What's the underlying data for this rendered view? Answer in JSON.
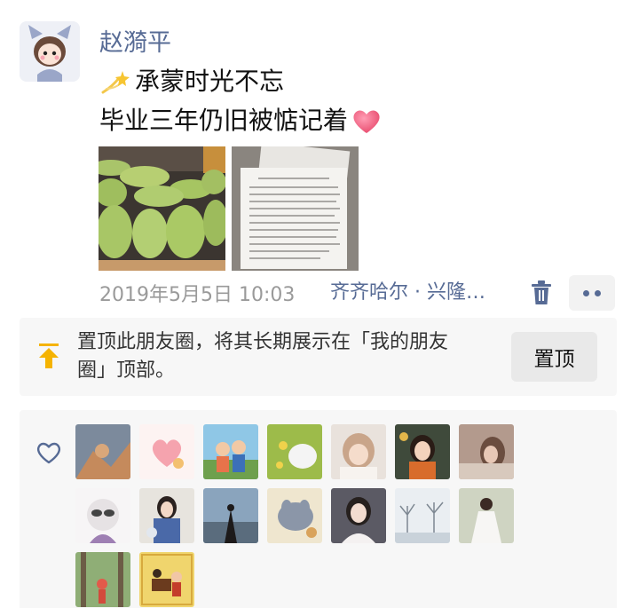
{
  "post": {
    "author": "赵漪平",
    "line1": "承蒙时光不忘",
    "line2": "毕业三年仍旧被惦记着",
    "timestamp": "2019年5月5日 10:03",
    "location": "齐齐哈尔 · 兴隆…"
  },
  "pin_notice": {
    "text": "置顶此朋友圈，将其长期展示在「我的朋友圈」顶部。",
    "button_label": "置顶"
  },
  "colors": {
    "link_blue": "#576b95",
    "pin_yellow": "#f5b301",
    "panel_bg": "#f7f7f7"
  },
  "icons": [
    "sparkle-emoji-icon",
    "heart-emoji-icon",
    "trash-icon",
    "more-dots-icon",
    "pin-top-icon",
    "like-heart-icon"
  ],
  "likers_count": 16
}
